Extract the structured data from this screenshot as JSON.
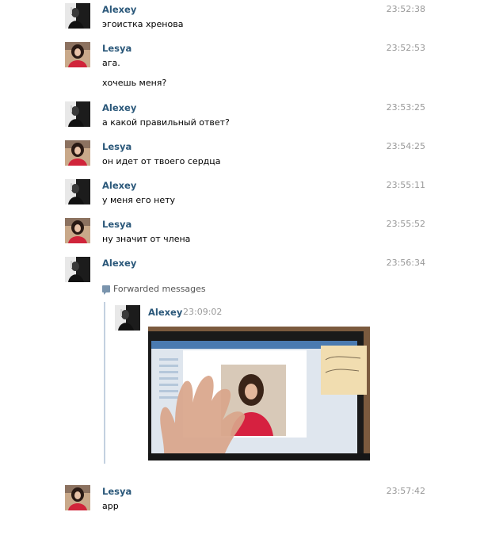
{
  "messages": [
    {
      "author": "Alexey",
      "time": "23:52:38",
      "lines": [
        "эгоистка хренова"
      ]
    },
    {
      "author": "Lesya",
      "time": "23:52:53",
      "lines": [
        "ага.",
        "хочешь меня?"
      ]
    },
    {
      "author": "Alexey",
      "time": "23:53:25",
      "lines": [
        "а какой правильный ответ?"
      ]
    },
    {
      "author": "Lesya",
      "time": "23:54:25",
      "lines": [
        "он идет от твоего сердца"
      ]
    },
    {
      "author": "Alexey",
      "time": "23:55:11",
      "lines": [
        "у меня его нету"
      ]
    },
    {
      "author": "Lesya",
      "time": "23:55:52",
      "lines": [
        "ну значит от члена"
      ]
    },
    {
      "author": "Alexey",
      "time": "23:56:34",
      "lines": []
    },
    {
      "author": "Lesya",
      "time": "23:57:42",
      "lines": [
        "app"
      ]
    }
  ],
  "forwarded": {
    "label": "Forwarded messages",
    "icon": "speech-bubble-icon",
    "author": "Alexey",
    "time": "23:09:02",
    "photo_icon": "photo-attachment",
    "sticky_note_text": "Вероника! Спасибо"
  },
  "colors": {
    "author": "#2b587a",
    "time": "#999999",
    "fwd_bar": "#c3d1e0"
  }
}
